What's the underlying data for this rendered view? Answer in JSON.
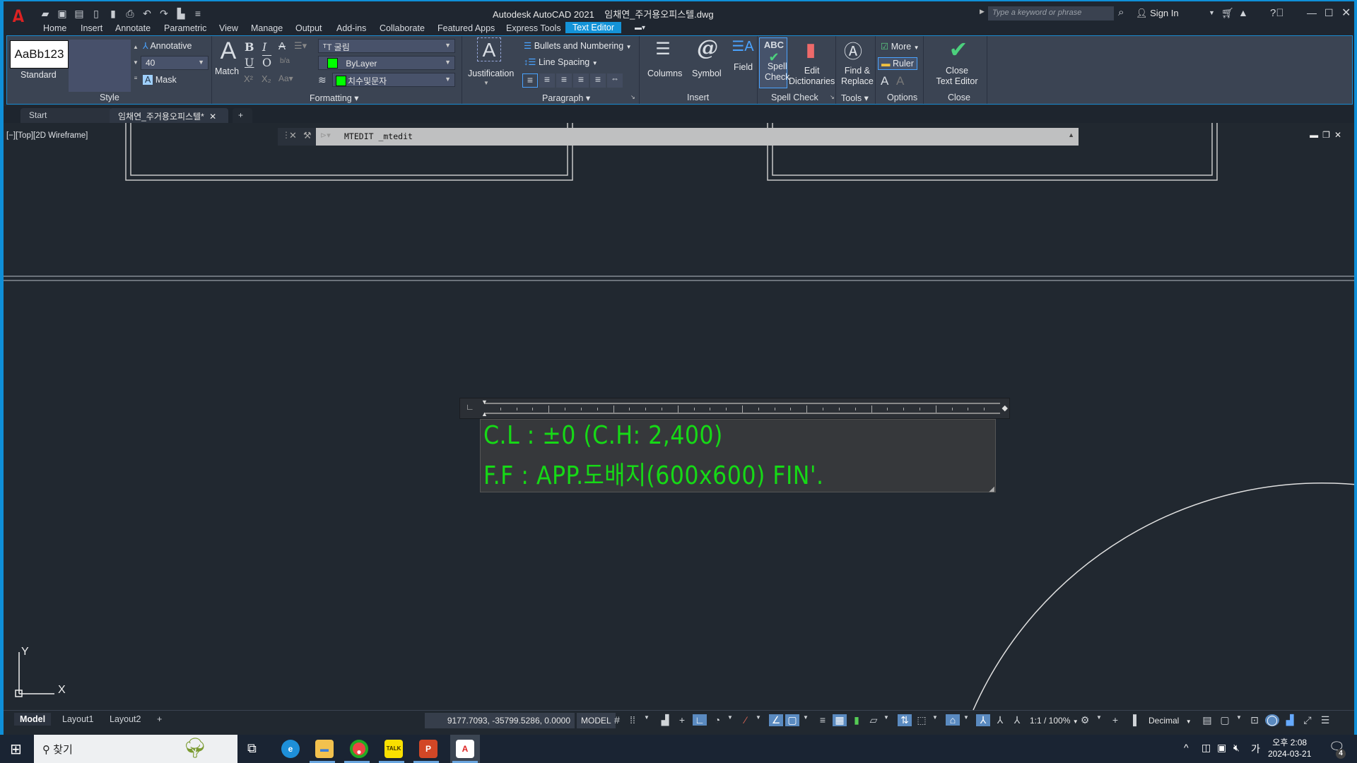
{
  "app": {
    "title": "Autodesk AutoCAD 2021",
    "filename": "임채연_주거용오피스텔.dwg",
    "search_placeholder": "Type a keyword or phrase",
    "sign_in": "Sign In"
  },
  "ribbon_tabs": [
    "Home",
    "Insert",
    "Annotate",
    "Parametric",
    "View",
    "Manage",
    "Output",
    "Add-ins",
    "Collaborate",
    "Featured Apps",
    "Express Tools",
    "Text Editor"
  ],
  "active_ribbon_tab": "Text Editor",
  "ribbon": {
    "style": {
      "preview": "AaBb123",
      "style_name": "Standard",
      "annotative": "Annotative",
      "text_height": "40",
      "mask": "Mask",
      "panel_title": "Style"
    },
    "formatting": {
      "match": "Match",
      "font": "굴림",
      "color": "ByLayer",
      "layer": "치수및문자",
      "panel_title": "Formatting",
      "color_swatch": "#00ff00"
    },
    "paragraph": {
      "justification": "Justification",
      "bullets": "Bullets and Numbering",
      "line_spacing": "Line Spacing",
      "panel_title": "Paragraph"
    },
    "insert": {
      "columns": "Columns",
      "symbol": "Symbol",
      "field": "Field",
      "panel_title": "Insert"
    },
    "spell_check": {
      "spell_check_line1": "Spell",
      "spell_check_line2": "Check",
      "edit_dict_line1": "Edit",
      "edit_dict_line2": "Dictionaries",
      "panel_title": "Spell Check"
    },
    "tools": {
      "find_line1": "Find &",
      "find_line2": "Replace",
      "panel_title": "Tools"
    },
    "options": {
      "more": "More",
      "ruler": "Ruler",
      "panel_title": "Options"
    },
    "close": {
      "close_line1": "Close",
      "close_line2": "Text Editor",
      "panel_title": "Close"
    }
  },
  "doc_tabs": [
    {
      "label": "Start"
    },
    {
      "label": "임채연_주거용오피스텔*"
    }
  ],
  "viewport": {
    "label": "[−][Top][2D Wireframe]",
    "command": "MTEDIT _mtedit",
    "ucs_x": "X",
    "ucs_y": "Y"
  },
  "mtext": {
    "lines": [
      "C.L : ±0 (C.H: 2,400)",
      "F.F : APP.도배지(600x600) FIN'."
    ],
    "color": "#16d916"
  },
  "layout_tabs": [
    "Model",
    "Layout1",
    "Layout2"
  ],
  "status": {
    "coordinates": "9177.7093, -35799.5286, 0.0000",
    "space": "MODEL",
    "annotation_scale": "1:1 / 100%",
    "units": "Decimal"
  },
  "taskbar": {
    "search": "찾기",
    "time": "오후 2:08",
    "date": "2024-03-21",
    "ime": "가",
    "notifications": "4"
  }
}
